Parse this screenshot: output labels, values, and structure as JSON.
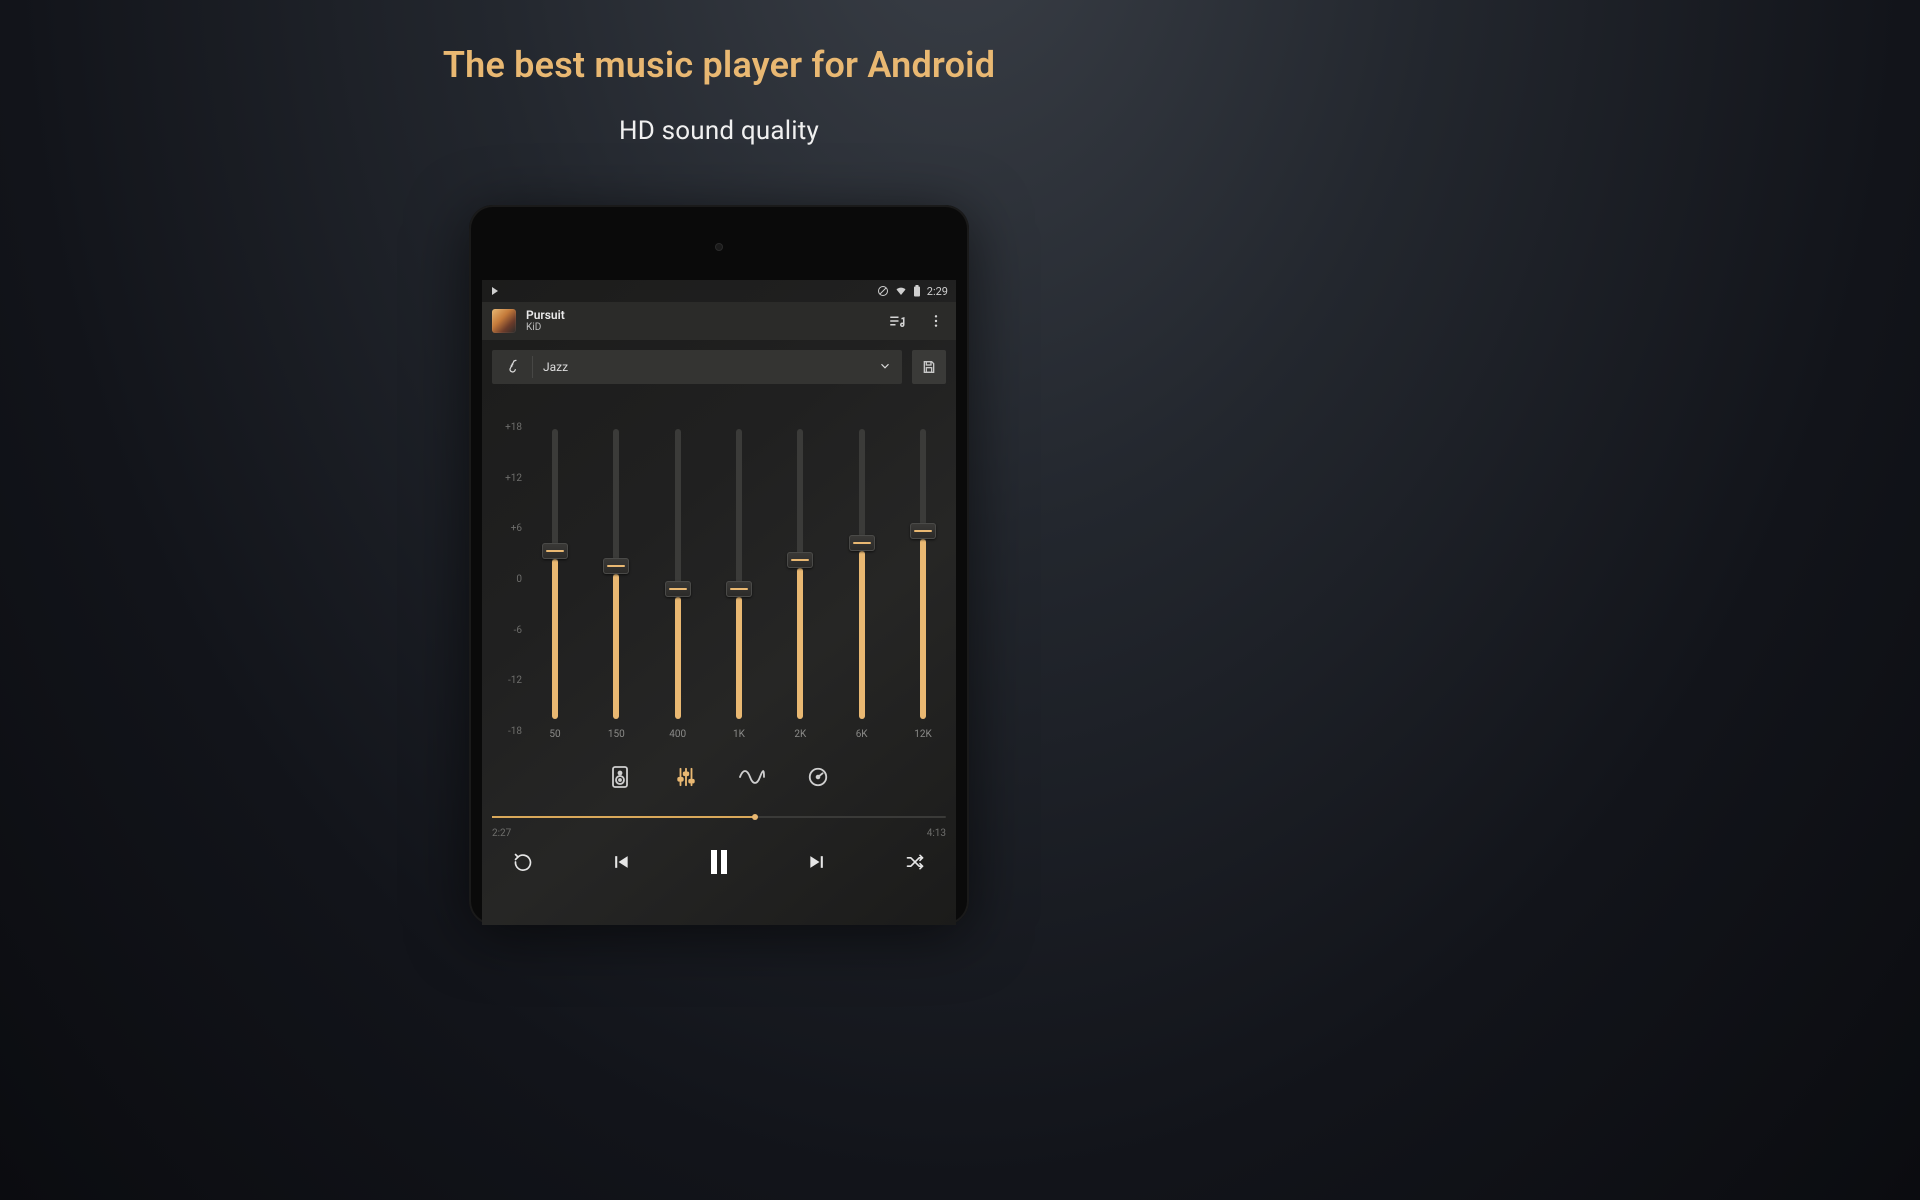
{
  "marketing": {
    "headline": "The best music player for Android",
    "subhead": "HD sound quality"
  },
  "statusbar": {
    "clock": "2:29"
  },
  "now_playing": {
    "title": "Pursuit",
    "artist": "KiD"
  },
  "preset": {
    "selected": "Jazz"
  },
  "equalizer": {
    "scale_labels": [
      "+18",
      "+12",
      "+6",
      "0",
      "-6",
      "-12",
      "-18"
    ],
    "bands": [
      {
        "freq": "50",
        "value_pct": 55
      },
      {
        "freq": "150",
        "value_pct": 50
      },
      {
        "freq": "400",
        "value_pct": 42
      },
      {
        "freq": "1K",
        "value_pct": 42
      },
      {
        "freq": "2K",
        "value_pct": 52
      },
      {
        "freq": "6K",
        "value_pct": 58
      },
      {
        "freq": "12K",
        "value_pct": 62
      }
    ]
  },
  "progress": {
    "elapsed": "2:27",
    "total": "4:13",
    "pct": 58
  }
}
